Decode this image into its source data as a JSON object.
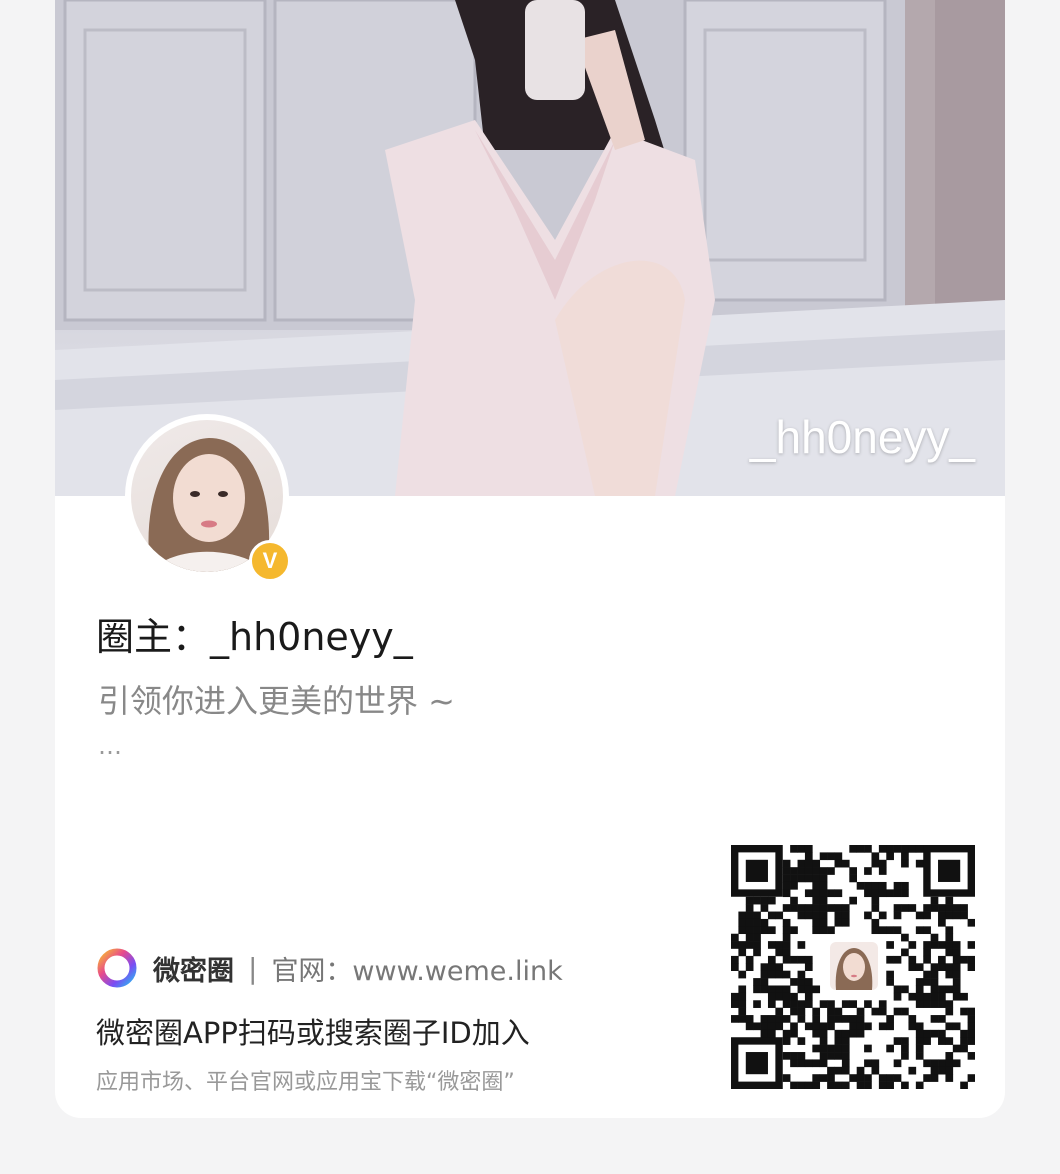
{
  "cover": {
    "username": "_hh0neyy_"
  },
  "profile": {
    "verified_badge": "V",
    "owner_label": "圈主：_hh0neyy_",
    "description": "引领你进入更美的世界 ~",
    "more_text": "…"
  },
  "footer": {
    "brand_name": "微密圈",
    "separator": "|",
    "site_label": "官网：www.weme.link",
    "join_text": "微密圈APP扫码或搜索圈子ID加入",
    "hint_text": "应用市场、平台官网或应用宝下载“微密圈”"
  },
  "colors": {
    "badge": "#f5b82e",
    "logo_ring": [
      "#f7b733",
      "#e84b8a",
      "#7a4cf3",
      "#2bb6f0"
    ]
  },
  "icons": [
    "verified-badge-icon",
    "weme-logo-icon",
    "qr-code"
  ]
}
